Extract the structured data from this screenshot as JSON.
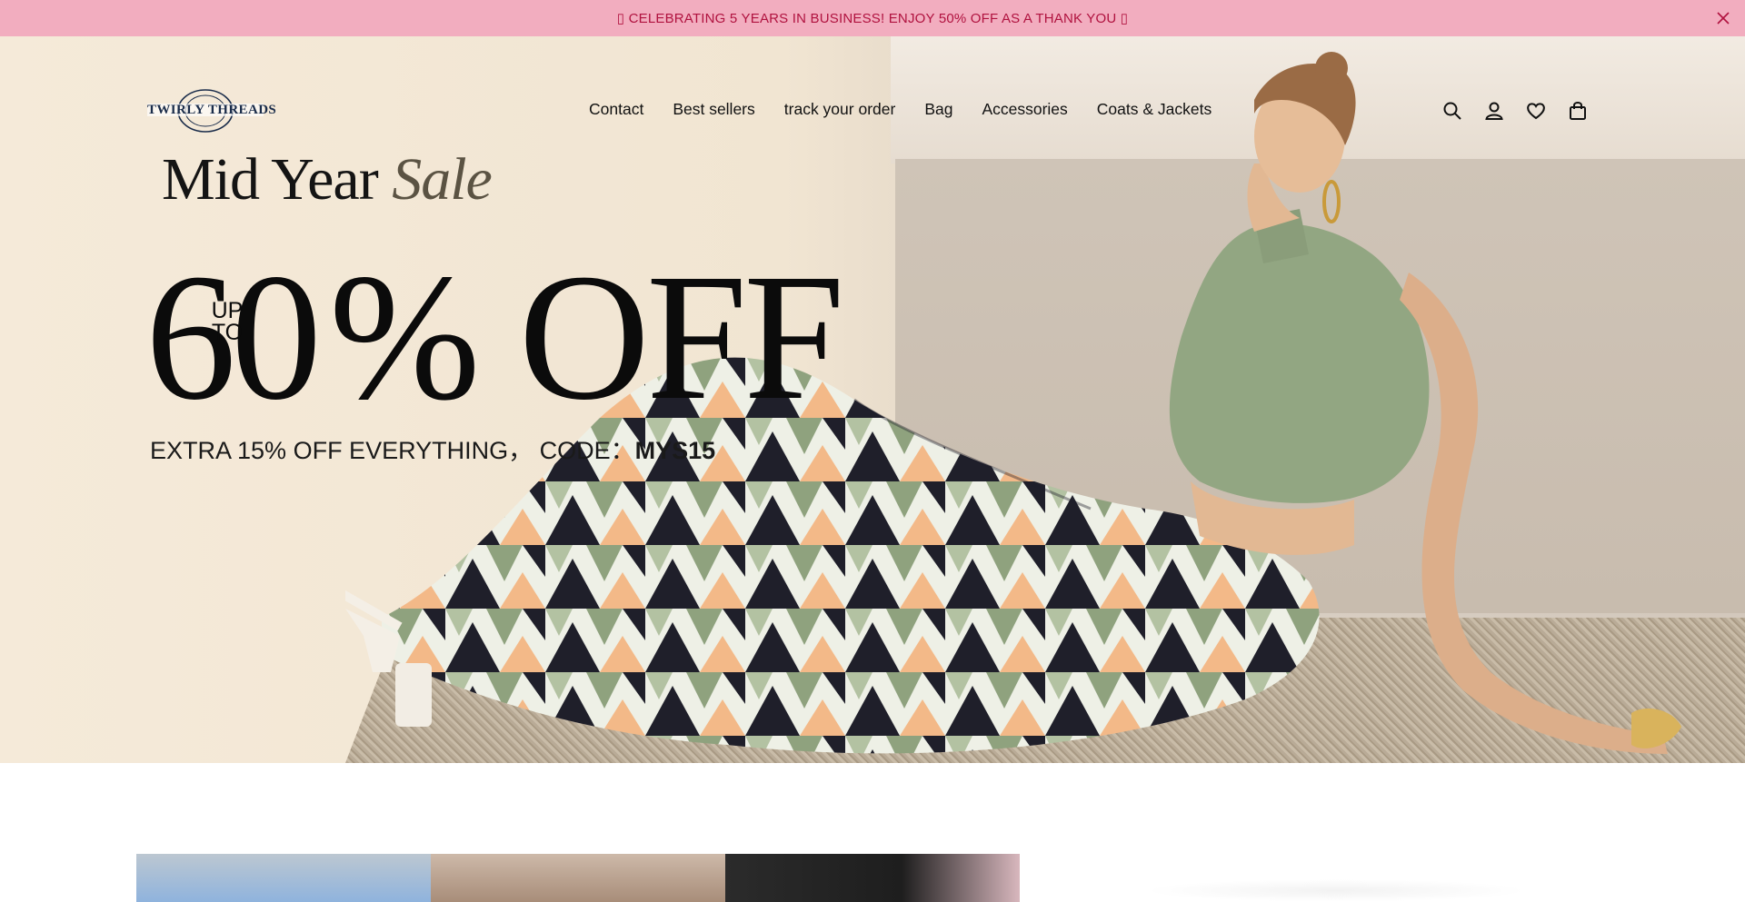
{
  "announcement": {
    "text": "▯ CELEBRATING 5 YEARS IN BUSINESS! ENJOY 50% OFF AS A THANK YOU ▯",
    "close_icon": "close-icon",
    "bg_color": "#f2adbf",
    "text_color": "#b0123f"
  },
  "brand": {
    "logo_text": "TWIRLY THREADS"
  },
  "nav": {
    "items": [
      {
        "label": "Contact"
      },
      {
        "label": "Best sellers"
      },
      {
        "label": "track your order"
      },
      {
        "label": "Bag"
      },
      {
        "label": "Accessories"
      },
      {
        "label": "Coats & Jackets"
      }
    ]
  },
  "header_icons": [
    "search-icon",
    "account-icon",
    "wishlist-icon",
    "cart-icon"
  ],
  "hero": {
    "kicker_main": "Mid Year",
    "kicker_accent": "Sale",
    "big_number": "60",
    "up": "UP",
    "to": "TO",
    "big_rest": "% OFF",
    "code_prefix": "EXTRA 15% OFF EVERYTHING， CODE：",
    "code_value": "MYS15"
  }
}
